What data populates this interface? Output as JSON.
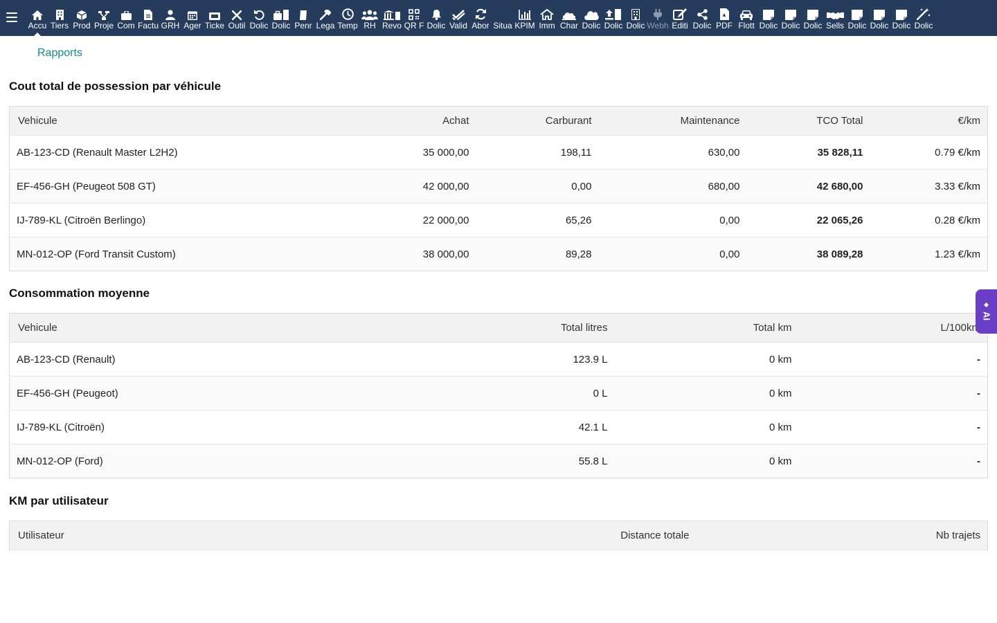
{
  "nav": {
    "items": [
      {
        "label": "Accu",
        "icon": "home-icon",
        "active": true
      },
      {
        "label": "Tiers",
        "icon": "building-icon"
      },
      {
        "label": "Prod",
        "icon": "cube-icon"
      },
      {
        "label": "Proje",
        "icon": "project-icon"
      },
      {
        "label": "Com",
        "icon": "briefcase-icon"
      },
      {
        "label": "Factu",
        "icon": "invoice-icon"
      },
      {
        "label": "GRH",
        "icon": "user-icon"
      },
      {
        "label": "Ager",
        "icon": "calendar-icon"
      },
      {
        "label": "Ticke",
        "icon": "ticket-icon"
      },
      {
        "label": "Outil",
        "icon": "tools-icon"
      },
      {
        "label": "Dolic",
        "icon": "undo-icon"
      },
      {
        "label": "Dolic",
        "icon": "briefcase-doc-icon"
      },
      {
        "label": "Penr",
        "icon": "gavel-icon"
      },
      {
        "label": "Lega",
        "icon": "hammer-icon"
      },
      {
        "label": "Temp",
        "icon": "clock-icon"
      },
      {
        "label": "RH",
        "icon": "users-icon"
      },
      {
        "label": "Revo",
        "icon": "bank-icon"
      },
      {
        "label": "QR F",
        "icon": "qrcode-icon"
      },
      {
        "label": "Dolic",
        "icon": "bell-icon"
      },
      {
        "label": "Valid",
        "icon": "double-check-icon"
      },
      {
        "label": "Abor",
        "icon": "refresh-icon"
      },
      {
        "label": "Situa",
        "icon": "empty-icon"
      },
      {
        "label": "KPIM",
        "icon": "bar-chart-icon"
      },
      {
        "label": "Imm",
        "icon": "house-icon"
      },
      {
        "label": "Char",
        "icon": "cloud-building-icon"
      },
      {
        "label": "Dolic",
        "icon": "cloud-icon"
      },
      {
        "label": "Dolic",
        "icon": "upload-doc-icon"
      },
      {
        "label": "Dolic",
        "icon": "office-icon"
      },
      {
        "label": "Webh",
        "icon": "plug-icon",
        "dim": true
      },
      {
        "label": "Editi",
        "icon": "edit-icon"
      },
      {
        "label": "Dolic",
        "icon": "share-icon"
      },
      {
        "label": "PDF",
        "icon": "pdf-icon"
      },
      {
        "label": "Flott",
        "icon": "car-icon"
      },
      {
        "label": "Dolic",
        "icon": "note-icon"
      },
      {
        "label": "Dolic",
        "icon": "note-icon"
      },
      {
        "label": "Dolic",
        "icon": "note-icon"
      },
      {
        "label": "Sells",
        "icon": "handshake-icon"
      },
      {
        "label": "Dolic",
        "icon": "note-icon"
      },
      {
        "label": "Dolic",
        "icon": "note-icon"
      },
      {
        "label": "Dolic",
        "icon": "note-icon"
      },
      {
        "label": "Dolic",
        "icon": "magic-wand-icon"
      }
    ]
  },
  "breadcrumb": "Rapports",
  "tco": {
    "title": "Cout total de possession par véhicule",
    "headers": [
      "Vehicule",
      "Achat",
      "Carburant",
      "Maintenance",
      "TCO Total",
      "€/km"
    ],
    "rows": [
      [
        "AB-123-CD (Renault Master L2H2)",
        "35 000,00",
        "198,11",
        "630,00",
        "35 828,11",
        "0.79 €/km"
      ],
      [
        "EF-456-GH (Peugeot 508 GT)",
        "42 000,00",
        "0,00",
        "680,00",
        "42 680,00",
        "3.33 €/km"
      ],
      [
        "IJ-789-KL (Citroën Berlingo)",
        "22 000,00",
        "65,26",
        "0,00",
        "22 065,26",
        "0.28 €/km"
      ],
      [
        "MN-012-OP (Ford Transit Custom)",
        "38 000,00",
        "89,28",
        "0,00",
        "38 089,28",
        "1.23 €/km"
      ]
    ]
  },
  "conso": {
    "title": "Consommation moyenne",
    "headers": [
      "Vehicule",
      "Total litres",
      "Total km",
      "L/100km"
    ],
    "rows": [
      [
        "AB-123-CD (Renault)",
        "123.9 L",
        "0 km",
        "-"
      ],
      [
        "EF-456-GH (Peugeot)",
        "0 L",
        "0 km",
        "-"
      ],
      [
        "IJ-789-KL (Citroën)",
        "42.1 L",
        "0 km",
        "-"
      ],
      [
        "MN-012-OP (Ford)",
        "55.8 L",
        "0 km",
        "-"
      ]
    ]
  },
  "km": {
    "title": "KM par utilisateur",
    "headers": [
      "Utilisateur",
      "Distance totale",
      "Nb trajets"
    ]
  },
  "ai_tab": {
    "label": "AI"
  },
  "colors": {
    "topbar": "#263c5c",
    "link": "#138a8a",
    "ai_accent": "#6a3ec6"
  }
}
